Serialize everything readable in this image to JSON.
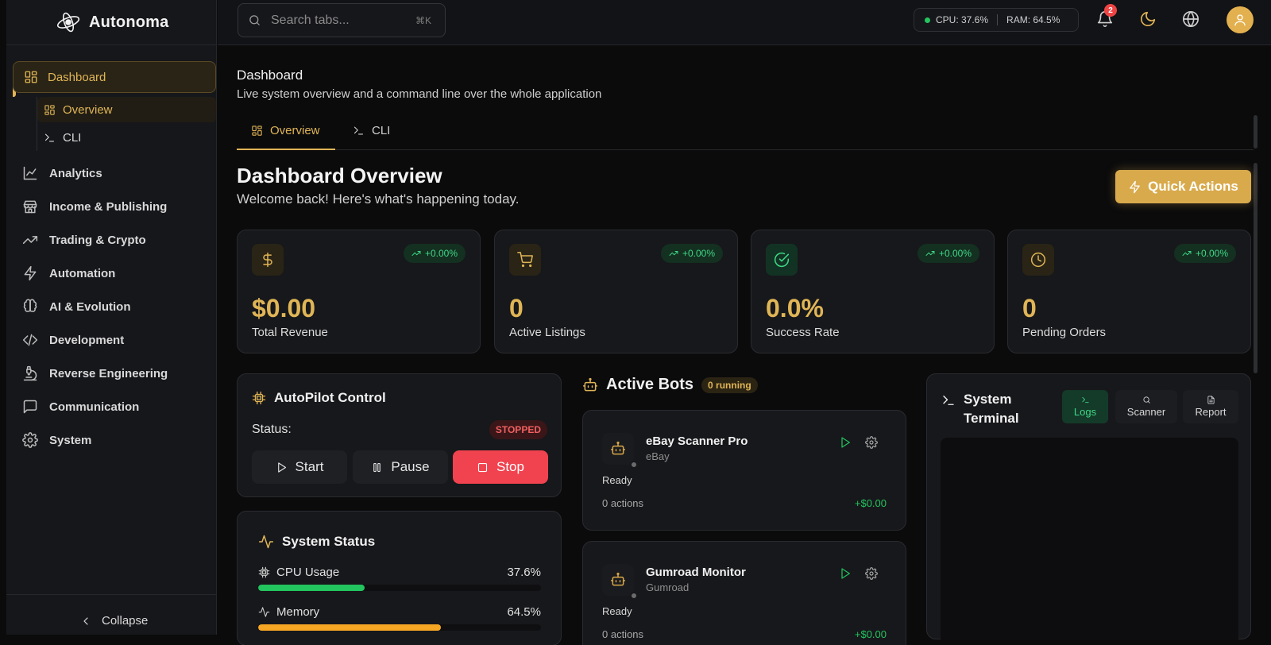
{
  "app": {
    "name": "Autonoma"
  },
  "search": {
    "placeholder": "Search tabs...",
    "shortcut": "⌘K"
  },
  "sysmon": {
    "cpu": "CPU: 37.6%",
    "ram": "RAM: 64.5%"
  },
  "notifications": {
    "count": "2"
  },
  "sidebar": {
    "active": "Dashboard",
    "subitems": [
      "Overview",
      "CLI"
    ],
    "items": [
      "Analytics",
      "Income & Publishing",
      "Trading & Crypto",
      "Automation",
      "AI & Evolution",
      "Development",
      "Reverse Engineering",
      "Communication",
      "System"
    ],
    "collapse": "Collapse"
  },
  "page": {
    "title": "Dashboard",
    "subtitle": "Live system overview and a command line over the whole application",
    "tabs": [
      "Overview",
      "CLI"
    ]
  },
  "overview": {
    "title": "Dashboard Overview",
    "subtitle": "Welcome back! Here's what's happening today.",
    "quick_actions": "Quick Actions"
  },
  "stats": [
    {
      "value": "$0.00",
      "label": "Total Revenue",
      "change": "+0.00%",
      "icon": "dollar-icon"
    },
    {
      "value": "0",
      "label": "Active Listings",
      "change": "+0.00%",
      "icon": "cart-icon"
    },
    {
      "value": "0.0%",
      "label": "Success Rate",
      "change": "+0.00%",
      "icon": "check-circle-icon"
    },
    {
      "value": "0",
      "label": "Pending Orders",
      "change": "+0.00%",
      "icon": "clock-icon"
    }
  ],
  "autopilot": {
    "title": "AutoPilot Control",
    "status_label": "Status:",
    "status": "STOPPED",
    "start": "Start",
    "pause": "Pause",
    "stop": "Stop"
  },
  "system_status": {
    "title": "System Status",
    "cpu_label": "CPU Usage",
    "cpu_value": "37.6%",
    "cpu_fraction": 0.376,
    "mem_label": "Memory",
    "mem_value": "64.5%",
    "mem_fraction": 0.645
  },
  "bots": {
    "title": "Active Bots",
    "running": "0 running",
    "list": [
      {
        "name": "eBay Scanner Pro",
        "source": "eBay",
        "status": "Ready",
        "actions": "0 actions",
        "earnings": "+$0.00"
      },
      {
        "name": "Gumroad Monitor",
        "source": "Gumroad",
        "status": "Ready",
        "actions": "0 actions",
        "earnings": "+$0.00"
      }
    ]
  },
  "terminal": {
    "title_line1": "System",
    "title_line2": "Terminal",
    "buttons": [
      "Logs",
      "Scanner",
      "Report"
    ]
  },
  "colors": {
    "accent": "#e0b556",
    "success": "#22c55e",
    "danger": "#f0434f",
    "memory": "#f5a623"
  }
}
